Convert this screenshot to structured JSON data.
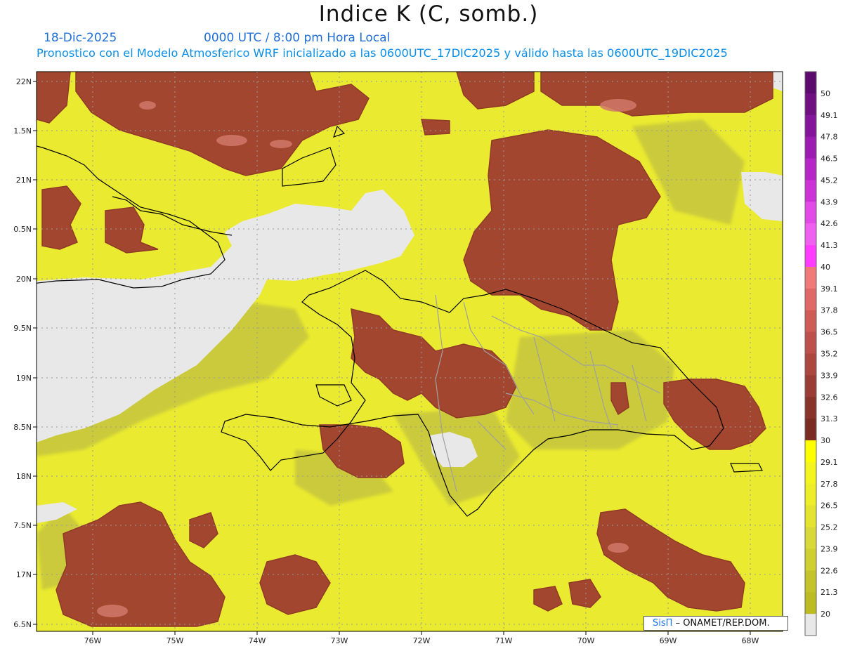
{
  "header": {
    "title": "Indice K (C, somb.)",
    "date": "18-Dic-2025",
    "time": "0000 UTC / 8:00 pm Hora Local",
    "description": "Pronostico con el Modelo Atmosferico WRF inicializado a las 0600UTC_17DIC2025 y válido hasta las  0600UTC_19DIC2025"
  },
  "map": {
    "lat_range": [
      16.5,
      22.1
    ],
    "lon_range": [
      -76.6,
      -67.6
    ],
    "lat_ticks": [
      "22N",
      "1.5N",
      "21N",
      "0.5N",
      "20N",
      "9.5N",
      "19N",
      "8.5N",
      "18N",
      "7.5N",
      "17N",
      "6.5N"
    ],
    "lon_ticks": [
      "76W",
      "75W",
      "74W",
      "73W",
      "72W",
      "71W",
      "70W",
      "69W",
      "68W"
    ],
    "grid": true,
    "ocean_yellow": "#eaea30",
    "land_olive": "#c8c840",
    "no_data": "#e8e8e8",
    "high_k": "#a04530"
  },
  "colorbar": {
    "labels": [
      "50",
      "49.1",
      "47.8",
      "46.5",
      "45.2",
      "43.9",
      "42.6",
      "41.3",
      "40",
      "39.1",
      "37.8",
      "36.5",
      "35.2",
      "33.9",
      "32.6",
      "31.3",
      "30",
      "29.1",
      "27.8",
      "26.5",
      "25.2",
      "23.9",
      "22.6",
      "21.3",
      "20"
    ],
    "colors": [
      "#5c0a6e",
      "#6f0f82",
      "#84149a",
      "#9c1cb2",
      "#b525c8",
      "#cd32d8",
      "#e14ae6",
      "#f060f0",
      "#ff3cff",
      "#f07a7a",
      "#e06868",
      "#cf5b56",
      "#bd504a",
      "#ac4740",
      "#9a3d36",
      "#88342b",
      "#7a2c22",
      "#ffff00",
      "#f4f41e",
      "#eded2a",
      "#e4e430",
      "#d8d838",
      "#cfcf30",
      "#c4c42a",
      "#bcbc22",
      "#e8e8e8"
    ]
  },
  "credit": {
    "brand": "SisΠ",
    "text": "– ONAMET/REP.DOM."
  }
}
